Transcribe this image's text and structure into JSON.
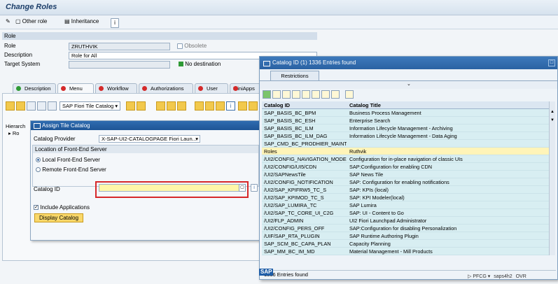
{
  "window": {
    "title": "Change Roles"
  },
  "toolbar": {
    "other_role": "Other role",
    "inheritance": "Inheritance"
  },
  "role_section": {
    "header": "Role",
    "role_label": "Role",
    "role_value": "ZRUTHVIK",
    "obsolete_label": "Obsolete",
    "description_label": "Description",
    "description_value": "Role for All",
    "target_system_label": "Target System",
    "no_destination_label": "No destination"
  },
  "tabs": [
    "Description",
    "Menu",
    "Workflow",
    "Authorizations",
    "User",
    "MiniApps"
  ],
  "menu_toolbar": {
    "fiori_tile_catalog": "SAP Fiori Tile Catalog",
    "hierarchy_label": "Hierarch",
    "root_label": "Ro"
  },
  "assign_dialog": {
    "title": "Assign Tile Catalog",
    "catalog_provider_label": "Catalog Provider",
    "catalog_provider_value": "X-SAP-UI2-CATALOGPAGE Fiori Laun...",
    "location_header": "Location of Front-End Server",
    "local_label": "Local Front-End Server",
    "remote_label": "Remote Front-End Server",
    "catalog_id_label": "Catalog ID",
    "catalog_id_value": "",
    "include_apps_label": "Include Applications",
    "display_catalog_button": "Display Catalog"
  },
  "catalog_popup": {
    "title": "Catalog ID (1)  1336 Entries found",
    "restrictions_tab": "Restrictions",
    "col_id": "Catalog ID",
    "col_title": "Catalog Title",
    "rows": [
      {
        "id": "SAP_BASIS_BC_BPM",
        "title": "Business Process Management"
      },
      {
        "id": "SAP_BASIS_BC_ESH",
        "title": "Enterprise Search"
      },
      {
        "id": "SAP_BASIS_BC_ILM",
        "title": "Information Lifecycle Management - Archiving"
      },
      {
        "id": "SAP_BASIS_BC_ILM_DAG",
        "title": "Information Lifecycle Management - Data Aging"
      },
      {
        "id": "SAP_CMD_BC_PRODHIER_MAINT",
        "title": ""
      },
      {
        "id": "Roles",
        "title": "Ruthvik"
      },
      {
        "id": "/UI2/CONFIG_NAVIGATION_MODE",
        "title": "Configuration for in-place navigation of classic UIs"
      },
      {
        "id": "/UI2/CONFIG/UI5/CDN",
        "title": "SAP:Configuration for enabling CDN"
      },
      {
        "id": "/UI2/SAPNewsTile",
        "title": "SAP News Tile"
      },
      {
        "id": "/UI2/CONFIG_NOTIFICATION",
        "title": "SAP: Configuration for enabling notifications"
      },
      {
        "id": "/UI2/SAP_KPIFRW5_TC_S",
        "title": "SAP: KPIs (local)"
      },
      {
        "id": "/UI2/SAP_KPIMOD_TC_S",
        "title": "SAP: KPI Modeler(local)"
      },
      {
        "id": "/UI2/SAP_LUMIRA_TC",
        "title": "SAP Lumira"
      },
      {
        "id": "/UI2/SAP_TC_CORE_UI_C2G",
        "title": "SAP: UI - Content to Go"
      },
      {
        "id": "/UI2/FLP_ADMIN",
        "title": "UI2 Fiori Launchpad Administrator"
      },
      {
        "id": "/UI2/CONFIG_PERS_OFF",
        "title": "SAP:Configuration for disabling Personalization"
      },
      {
        "id": "/UIF/SAP_RTA_PLUGIN",
        "title": "SAP Runtime Authoring Plugin"
      },
      {
        "id": "SAP_SCM_BC_CAPA_PLAN",
        "title": "Capacity Planning"
      },
      {
        "id": "SAP_MM_BC_IM_MD",
        "title": "Material Management - Mill Products"
      }
    ],
    "selected_row": 5,
    "footer": "1336 Entries found"
  },
  "status_bar": {
    "brand": "SAP",
    "transaction": "PFCG",
    "system": "saps4h2",
    "mode": "OVR"
  },
  "colors": {
    "title_blue": "#2a62a3",
    "selected_row": "#fff4b8",
    "grid_row": "#d8eef2",
    "highlight_red": "#d6282a"
  }
}
